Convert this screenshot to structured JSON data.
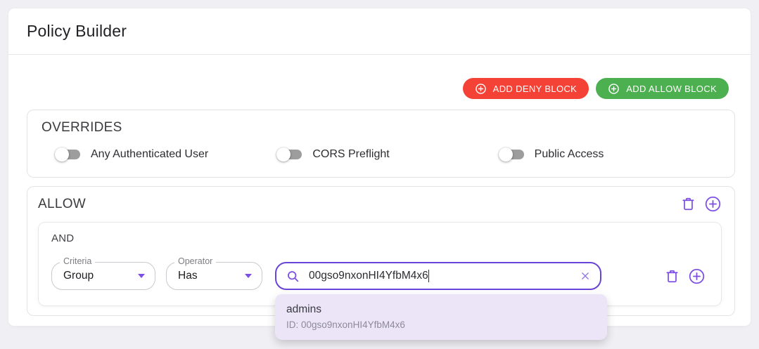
{
  "page": {
    "title": "Policy Builder"
  },
  "toolbar": {
    "add_deny_label": "ADD DENY BLOCK",
    "add_allow_label": "ADD ALLOW BLOCK"
  },
  "overrides": {
    "title": "OVERRIDES",
    "toggles": [
      {
        "label": "Any Authenticated User",
        "state": "off"
      },
      {
        "label": "CORS Preflight",
        "state": "off"
      },
      {
        "label": "Public Access",
        "state": "off"
      }
    ]
  },
  "allow_block": {
    "title": "ALLOW",
    "group": {
      "logic_label": "AND",
      "criteria": {
        "label": "Criteria",
        "value": "Group"
      },
      "operator": {
        "label": "Operator",
        "value": "Has"
      },
      "search_value": "00gso9nxonHI4YfbM4x6"
    }
  },
  "suggestion": {
    "name": "admins",
    "id_line": "ID: 00gso9nxonHI4YfbM4x6"
  },
  "icons": {
    "button_icon": "plus-circle-icon",
    "delete_icon": "trash-icon",
    "add_icon": "plus-circle-icon",
    "search_icon": "magnifier-icon",
    "clear_icon": "x-icon",
    "select_caret": "caret-down-icon"
  },
  "colors": {
    "deny_red": "#f44336",
    "allow_green": "#4caf50",
    "accent_purple": "#7d4ee3",
    "search_border_purple": "#6a43d8",
    "suggestion_bg": "#ebe5f7",
    "toggle_track_gray": "#9d9d9d",
    "page_bg": "#f0eff4"
  }
}
